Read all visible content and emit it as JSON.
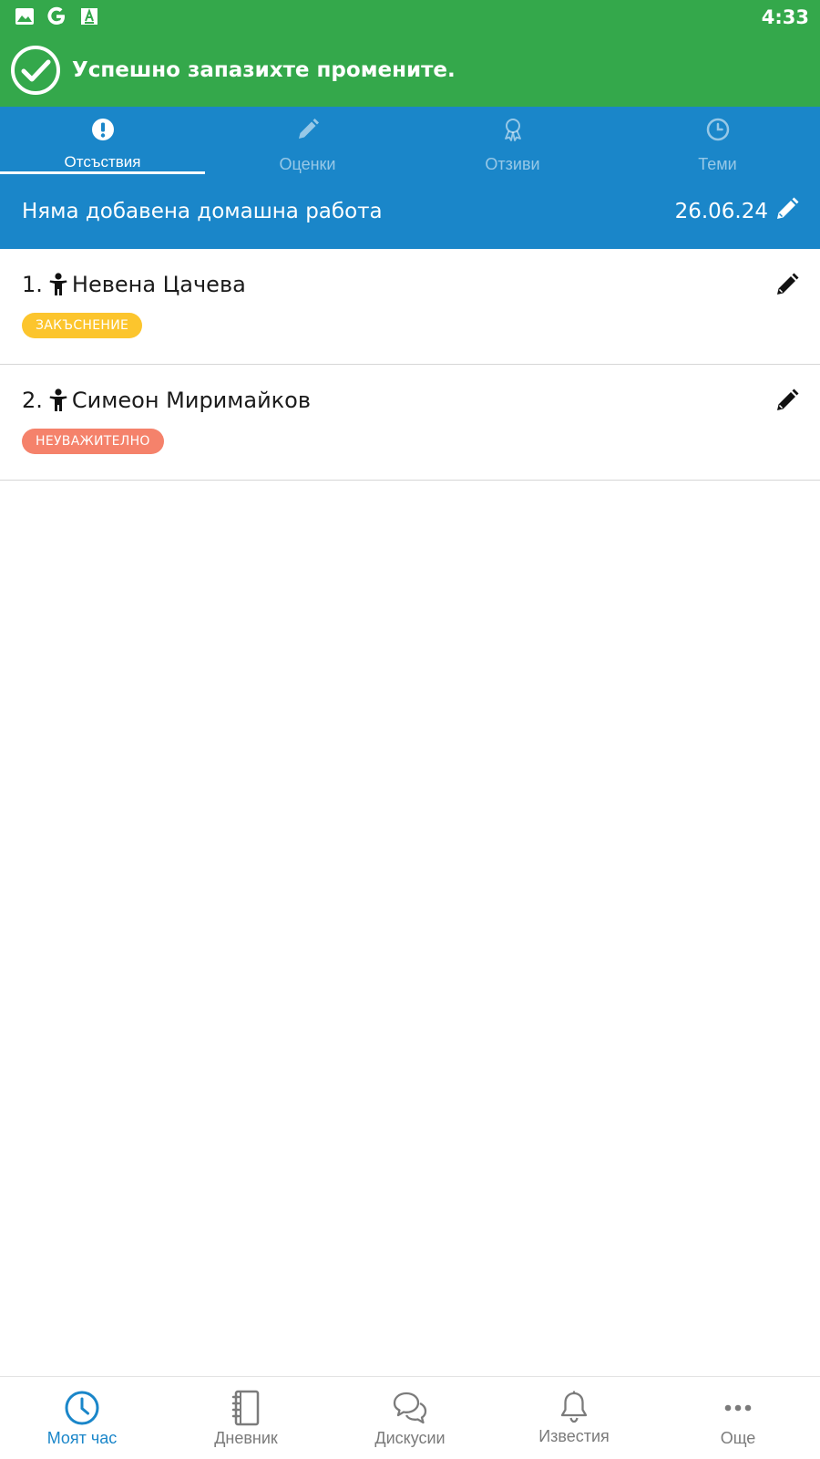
{
  "status_bar": {
    "time": "4:33",
    "icons": [
      "image-icon",
      "google-icon",
      "app-font-icon"
    ]
  },
  "toast": {
    "message": "Успешно запазихте промените.",
    "icon": "check-circle-icon"
  },
  "tabs": [
    {
      "label": "Отсъствия",
      "icon": "exclamation-circle-icon",
      "active": true
    },
    {
      "label": "Оценки",
      "icon": "pencil-icon",
      "active": false
    },
    {
      "label": "Отзиви",
      "icon": "award-ribbon-icon",
      "active": false
    },
    {
      "label": "Теми",
      "icon": "clock-icon",
      "active": false
    }
  ],
  "homework": {
    "text": "Няма добавена домашна работа",
    "date": "26.06.24"
  },
  "students": [
    {
      "number": "1.",
      "name": "Невена Цачева",
      "status": "ЗАКЪСНЕНИЕ",
      "status_color": "#fcc52d"
    },
    {
      "number": "2.",
      "name": "Симеон Миримайков",
      "status": "НЕУВАЖИТЕЛНО",
      "status_color": "#f5826b"
    }
  ],
  "bottom_nav": [
    {
      "label": "Моят час",
      "icon": "clock-icon",
      "active": true
    },
    {
      "label": "Дневник",
      "icon": "notebook-icon",
      "active": false
    },
    {
      "label": "Дискусии",
      "icon": "chat-bubbles-icon",
      "active": false
    },
    {
      "label": "Известия",
      "icon": "bell-icon",
      "active": false
    },
    {
      "label": "Още",
      "icon": "more-dots-icon",
      "active": false
    }
  ],
  "colors": {
    "green": "#34a84b",
    "blue": "#1a86c9",
    "late": "#fcc52d",
    "unexcused": "#f5826b"
  }
}
